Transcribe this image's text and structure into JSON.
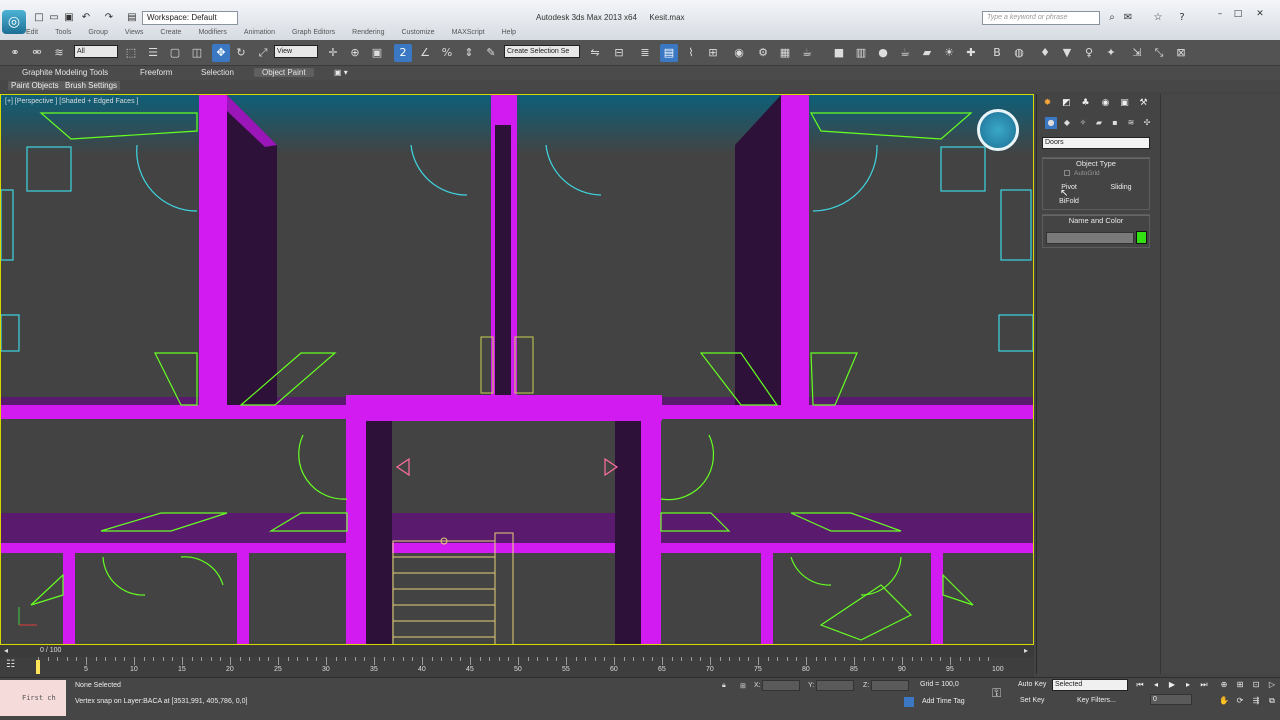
{
  "titlebar": {
    "workspace": "Workspace: Default",
    "app_title": "Autodesk 3ds Max 2013 x64",
    "file_name": "Kesit.max",
    "help_search_placeholder": "Type a keyword or phrase"
  },
  "menu": [
    "Edit",
    "Tools",
    "Group",
    "Views",
    "Create",
    "Modifiers",
    "Animation",
    "Graph Editors",
    "Rendering",
    "Customize",
    "MAXScript",
    "Help"
  ],
  "toolbar": {
    "selection_filter": "All",
    "ref_coord": "View",
    "named_selection_placeholder": "Create Selection Se"
  },
  "ribbon": {
    "tabs": [
      "Graphite Modeling Tools",
      "Freeform",
      "Selection",
      "Object Paint"
    ],
    "subtabs": [
      "Paint Objects",
      "Brush Settings"
    ]
  },
  "viewport": {
    "label": "[+] [Perspective ] [Shaded + Edged Faces ]"
  },
  "command_panel": {
    "category": "Doors",
    "object_type_title": "Object Type",
    "autogrid_label": "AutoGrid",
    "object_types": [
      "Pivot",
      "Sliding",
      "BiFold"
    ],
    "name_and_color_title": "Name and Color",
    "object_color": "#33e014"
  },
  "timeline": {
    "frame_label": "0 / 100",
    "ticks": [
      "0",
      "5",
      "10",
      "15",
      "20",
      "25",
      "30",
      "35",
      "40",
      "45",
      "50",
      "55",
      "60",
      "65",
      "70",
      "75",
      "80",
      "85",
      "90",
      "95",
      "100"
    ]
  },
  "status": {
    "maxscript_line": "First ch",
    "selection": "None Selected",
    "prompt": "Vertex snap on Layer:BACA at [3531,991, 405,786, 0,0]",
    "x_label": "X:",
    "y_label": "Y:",
    "z_label": "Z:",
    "grid": "Grid = 100,0",
    "add_time_tag": "Add Time Tag",
    "auto_key": "Auto Key",
    "set_key": "Set Key",
    "key_mode": "Selected",
    "key_filters": "Key Filters...",
    "current_frame": "0"
  },
  "colors": {
    "wall": "#d11bf0",
    "wall_shadow": "#2d1138",
    "door_symbol": "#3fd5e0",
    "stairs": "#66ff22",
    "viewport_bg": "#434343",
    "selection_accent": "#3a78c4"
  }
}
